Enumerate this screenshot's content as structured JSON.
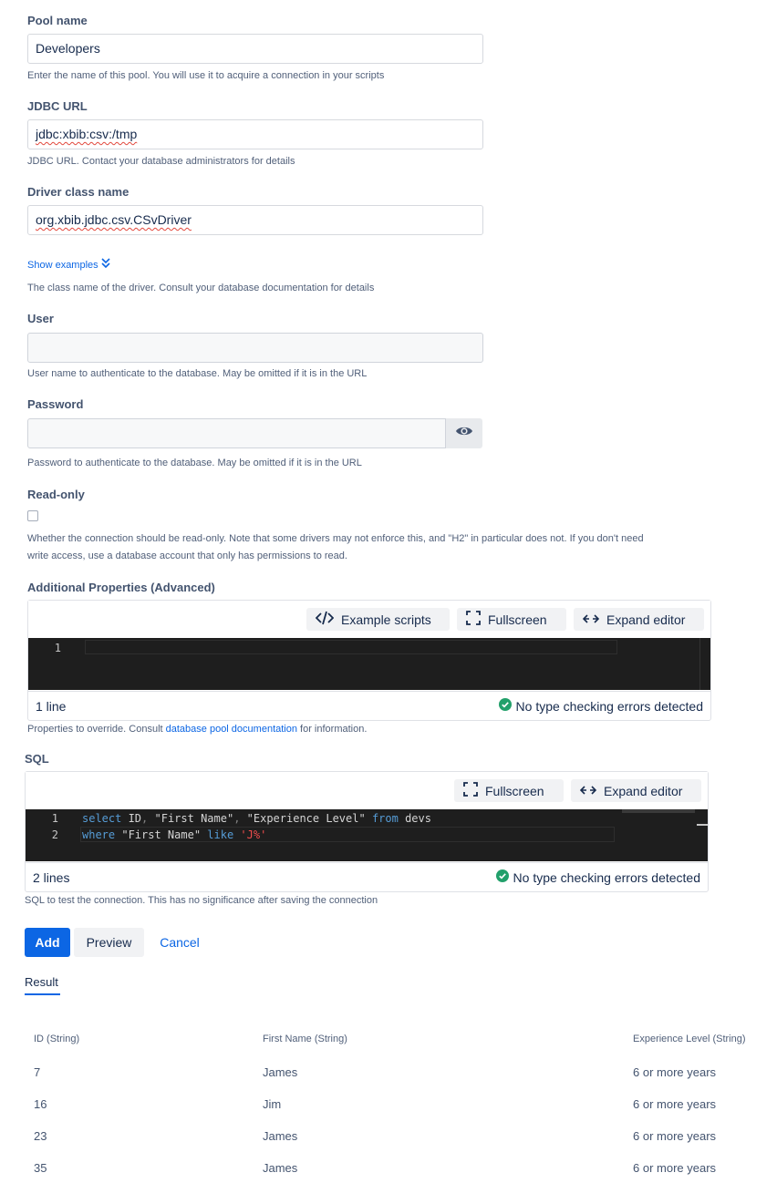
{
  "pool_name": {
    "label": "Pool name",
    "value": "Developers",
    "help": "Enter the name of this pool. You will use it to acquire a connection in your scripts"
  },
  "jdbc_url": {
    "label": "JDBC URL",
    "value": "jdbc:xbib:csv:/tmp",
    "help": "JDBC URL. Contact your database administrators for details"
  },
  "driver": {
    "label": "Driver class name",
    "value": "org.xbib.jdbc.csv.CSvDriver",
    "show_examples": "Show examples",
    "help": "The class name of the driver. Consult your database documentation for details"
  },
  "user": {
    "label": "User",
    "value": "",
    "help": "User name to authenticate to the database. May be omitted if it is in the URL"
  },
  "password": {
    "label": "Password",
    "value": "",
    "help": "Password to authenticate to the database. May be omitted if it is in the URL"
  },
  "read_only": {
    "label": "Read-only",
    "checked": false,
    "help_line1": "Whether the connection should be read-only. Note that some drivers may not enforce this, and \"H2\" in particular does not. If you don't need",
    "help_line2": "write access, use a database account that only has permissions to read."
  },
  "properties": {
    "label": "Additional Properties (Advanced)",
    "buttons": {
      "examples": "Example scripts",
      "fullscreen": "Fullscreen",
      "expand": "Expand editor"
    },
    "line_numbers": [
      "1"
    ],
    "footer_lines": "1 line",
    "footer_status": "No type checking errors detected",
    "help_prefix": "Properties to override. Consult ",
    "help_link": "database pool documentation",
    "help_suffix": " for information."
  },
  "sql": {
    "label": "SQL",
    "buttons": {
      "fullscreen": "Fullscreen",
      "expand": "Expand editor"
    },
    "line_numbers": [
      "1",
      "2"
    ],
    "code": {
      "l1_kw1": "select",
      "l1_a": " ID",
      "l1_comma1": ",",
      "l1_b": " \"First Name\"",
      "l1_comma2": ",",
      "l1_c": " \"Experience Level\" ",
      "l1_kw2": "from",
      "l1_d": " devs",
      "l2_kw1": "where",
      "l2_a": " \"First Name\" ",
      "l2_kw2": "like",
      "l2_space": " ",
      "l2_str": "'J%'"
    },
    "footer_lines": "2 lines",
    "footer_status": "No type checking errors detected",
    "help": "SQL to test the connection. This has no significance after saving the connection"
  },
  "actions": {
    "add": "Add",
    "preview": "Preview",
    "cancel": "Cancel"
  },
  "result": {
    "tab": "Result",
    "columns": [
      "ID (String)",
      "First Name (String)",
      "Experience Level (String)"
    ],
    "rows": [
      [
        "7",
        "James",
        "6 or more years"
      ],
      [
        "16",
        "Jim",
        "6 or more years"
      ],
      [
        "23",
        "James",
        "6 or more years"
      ],
      [
        "35",
        "James",
        "6 or more years"
      ]
    ]
  },
  "colors": {
    "primary": "#0c66e4",
    "success": "#22a06b",
    "editor_bg": "#1e1e1e",
    "keyword": "#569cd6",
    "string": "#f14c4c"
  }
}
